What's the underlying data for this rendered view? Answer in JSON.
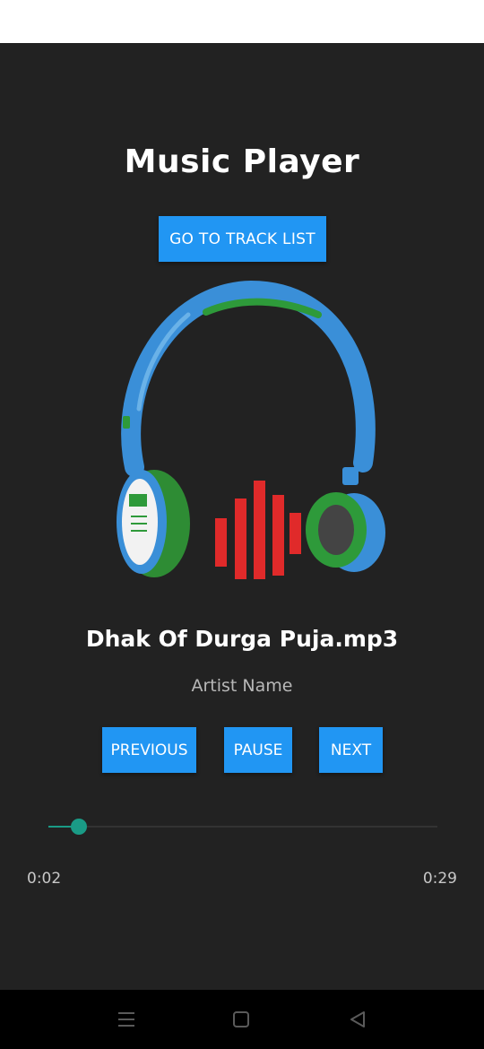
{
  "app": {
    "title": "Music Player",
    "track_list_button": "GO TO TRACK LIST"
  },
  "now_playing": {
    "track_title": "Dhak Of Durga Puja.mp3",
    "artist": "Artist Name",
    "album_art_icon": "headphones-icon"
  },
  "controls": {
    "previous_label": "PREVIOUS",
    "pause_label": "PAUSE",
    "next_label": "NEXT"
  },
  "progress": {
    "current_time": "0:02",
    "total_time": "0:29",
    "fraction": 0.078,
    "accent_color": "#1a9b86"
  },
  "nav": {
    "menu_icon": "menu-icon",
    "home_icon": "home-icon",
    "back_icon": "back-icon"
  },
  "colors": {
    "background": "#222222",
    "button": "#2196f3"
  }
}
